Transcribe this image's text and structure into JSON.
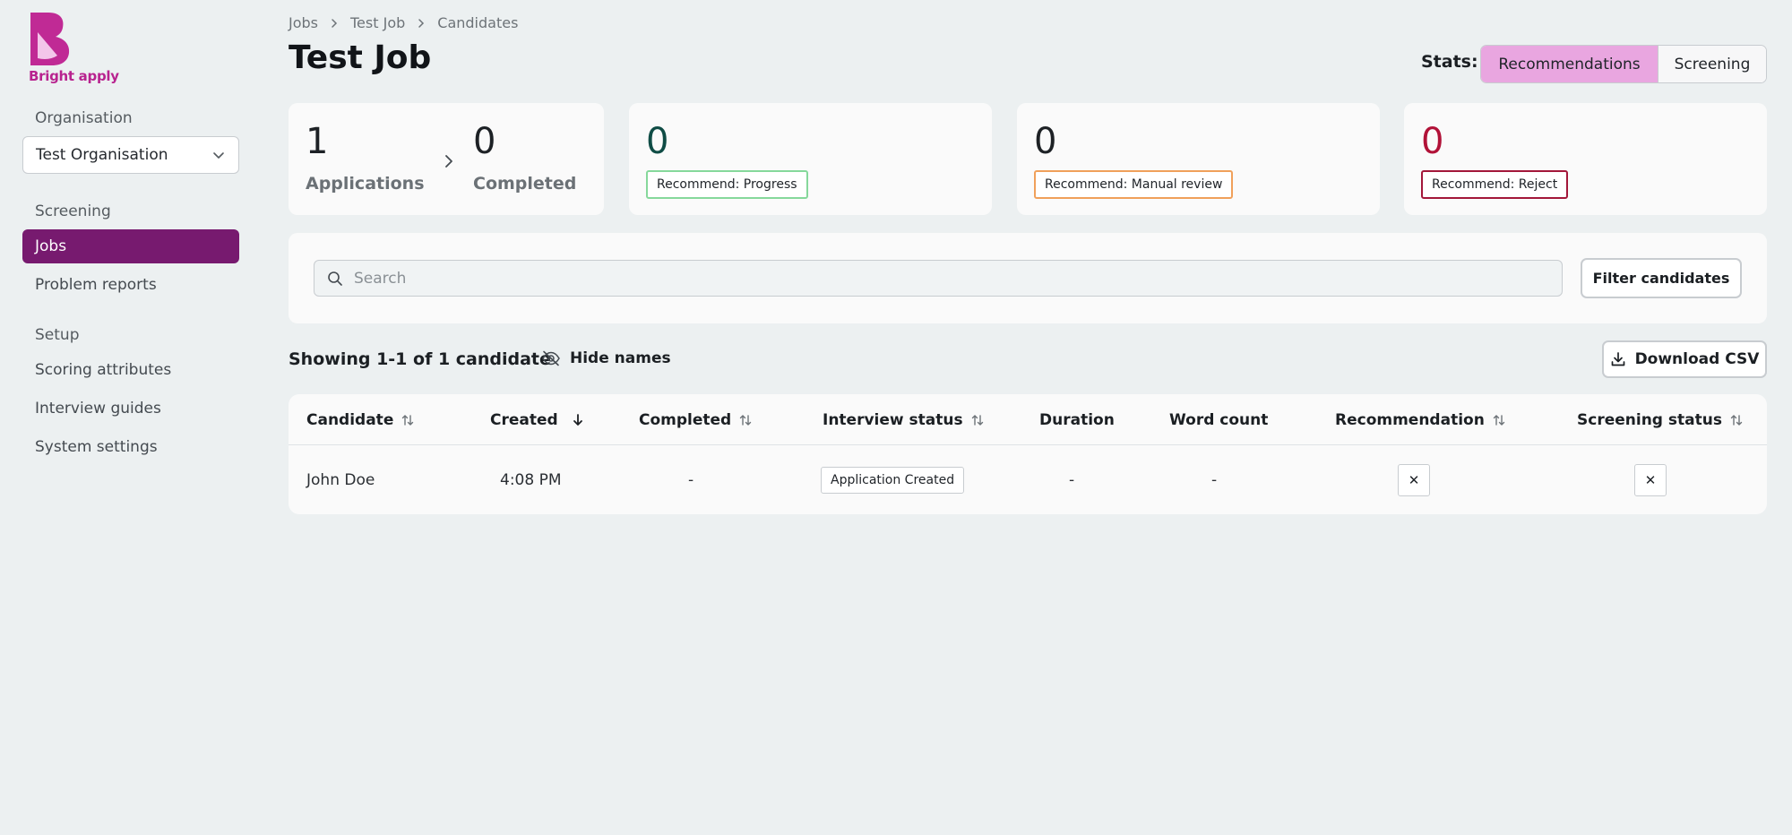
{
  "brand": {
    "name": "Bright apply",
    "color": "#b8238f"
  },
  "sidebar": {
    "organisation_heading": "Organisation",
    "organisation_value": "Test Organisation",
    "screening_heading": "Screening",
    "screening_items": [
      {
        "label": "Jobs",
        "active": true
      },
      {
        "label": "Problem reports",
        "active": false
      }
    ],
    "setup_heading": "Setup",
    "setup_items": [
      {
        "label": "Scoring attributes"
      },
      {
        "label": "Interview guides"
      },
      {
        "label": "System settings"
      }
    ]
  },
  "breadcrumb": [
    "Jobs",
    "Test Job",
    "Candidates"
  ],
  "page_title": "Test Job",
  "stats": {
    "label": "Stats:",
    "options": [
      "Recommendations",
      "Screening"
    ],
    "selected": "Recommendations"
  },
  "cards": {
    "applications": {
      "value": "1",
      "label": "Applications"
    },
    "completed": {
      "value": "0",
      "label": "Completed"
    },
    "progress": {
      "value": "0",
      "badge": "Recommend: Progress",
      "color": "#0f4c45",
      "border": "#86d89b"
    },
    "manual": {
      "value": "0",
      "badge": "Recommend: Manual review",
      "color": "#1d2125",
      "border": "#f0a05a"
    },
    "reject": {
      "value": "0",
      "badge": "Recommend: Reject",
      "color": "#b11238",
      "border": "#a3173a"
    }
  },
  "search": {
    "placeholder": "Search",
    "value": ""
  },
  "filter_label": "Filter candidates",
  "results": {
    "showing": "Showing 1-1 of 1 candidate",
    "hide_names": "Hide names",
    "download_csv": "Download CSV"
  },
  "table": {
    "columns": [
      "Candidate",
      "Created",
      "Completed",
      "Interview status",
      "Duration",
      "Word count",
      "Recommendation",
      "Screening status"
    ],
    "rows": [
      {
        "candidate": "John Doe",
        "created": "4:08 PM",
        "completed": "-",
        "interview_status": "Application Created",
        "duration": "-",
        "word_count": "-",
        "recommendation": "✕",
        "screening_status": "✕"
      }
    ]
  }
}
